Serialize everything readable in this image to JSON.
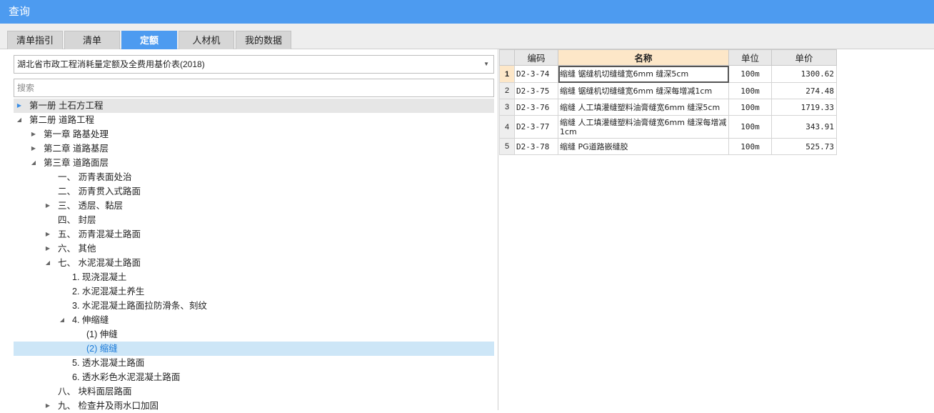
{
  "window": {
    "title": "查询"
  },
  "tabs": [
    {
      "label": "清单指引",
      "active": false
    },
    {
      "label": "清单",
      "active": false
    },
    {
      "label": "定额",
      "active": true
    },
    {
      "label": "人材机",
      "active": false
    },
    {
      "label": "我的数据",
      "active": false
    }
  ],
  "left": {
    "library": "湖北省市政工程消耗量定额及全费用基价表(2018)",
    "search_placeholder": "搜索",
    "tree": [
      {
        "label": "第一册 土石方工程",
        "level": 0,
        "toggle": "collapsed",
        "state": "highlight"
      },
      {
        "label": "第二册 道路工程",
        "level": 0,
        "toggle": "expanded",
        "state": ""
      },
      {
        "label": "第一章 路基处理",
        "level": 1,
        "toggle": "collapsed",
        "state": ""
      },
      {
        "label": "第二章 道路基层",
        "level": 1,
        "toggle": "collapsed",
        "state": ""
      },
      {
        "label": "第三章 道路面层",
        "level": 1,
        "toggle": "expanded",
        "state": ""
      },
      {
        "label": "一、 沥青表面处治",
        "level": 2,
        "toggle": "none",
        "state": ""
      },
      {
        "label": "二、 沥青贯入式路面",
        "level": 2,
        "toggle": "none",
        "state": ""
      },
      {
        "label": "三、 透层、黏层",
        "level": 2,
        "toggle": "collapsed",
        "state": ""
      },
      {
        "label": "四、 封层",
        "level": 2,
        "toggle": "none",
        "state": ""
      },
      {
        "label": "五、 沥青混凝土路面",
        "level": 2,
        "toggle": "collapsed",
        "state": ""
      },
      {
        "label": "六、 其他",
        "level": 2,
        "toggle": "collapsed",
        "state": ""
      },
      {
        "label": "七、 水泥混凝土路面",
        "level": 2,
        "toggle": "expanded",
        "state": ""
      },
      {
        "label": "1. 现浇混凝土",
        "level": 3,
        "toggle": "none",
        "state": ""
      },
      {
        "label": "2. 水泥混凝土养生",
        "level": 3,
        "toggle": "none",
        "state": ""
      },
      {
        "label": "3. 水泥混凝土路面拉防滑条、刻纹",
        "level": 3,
        "toggle": "none",
        "state": ""
      },
      {
        "label": "4. 伸缩缝",
        "level": 3,
        "toggle": "expanded",
        "state": ""
      },
      {
        "label": "(1) 伸缝",
        "level": 4,
        "toggle": "none",
        "state": ""
      },
      {
        "label": "(2) 缩缝",
        "level": 4,
        "toggle": "none",
        "state": "selected"
      },
      {
        "label": "5. 透水混凝土路面",
        "level": 3,
        "toggle": "none",
        "state": ""
      },
      {
        "label": "6. 透水彩色水泥混凝土路面",
        "level": 3,
        "toggle": "none",
        "state": ""
      },
      {
        "label": "八、 块料面层路面",
        "level": 2,
        "toggle": "none",
        "state": ""
      },
      {
        "label": "九、 检查井及雨水口加固",
        "level": 2,
        "toggle": "collapsed",
        "state": ""
      }
    ]
  },
  "table": {
    "headers": {
      "index": "",
      "code": "编码",
      "name": "名称",
      "unit": "单位",
      "price": "单价"
    },
    "rows": [
      {
        "index": "1",
        "code": "D2-3-74",
        "name": "缩缝 锯缝机切缝缝宽6mm 缝深5cm",
        "unit": "100m",
        "price": "1300.62",
        "current": true
      },
      {
        "index": "2",
        "code": "D2-3-75",
        "name": "缩缝 锯缝机切缝缝宽6mm 缝深每增减1cm",
        "unit": "100m",
        "price": "274.48",
        "current": false
      },
      {
        "index": "3",
        "code": "D2-3-76",
        "name": "缩缝 人工填灌缝塑料油膏缝宽6mm 缝深5cm",
        "unit": "100m",
        "price": "1719.33",
        "current": false
      },
      {
        "index": "4",
        "code": "D2-3-77",
        "name": "缩缝 人工填灌缝塑料油膏缝宽6mm 缝深每增减1cm",
        "unit": "100m",
        "price": "343.91",
        "current": false
      },
      {
        "index": "5",
        "code": "D2-3-78",
        "name": "缩缝 PG道路嵌缝胶",
        "unit": "100m",
        "price": "525.73",
        "current": false
      }
    ]
  }
}
